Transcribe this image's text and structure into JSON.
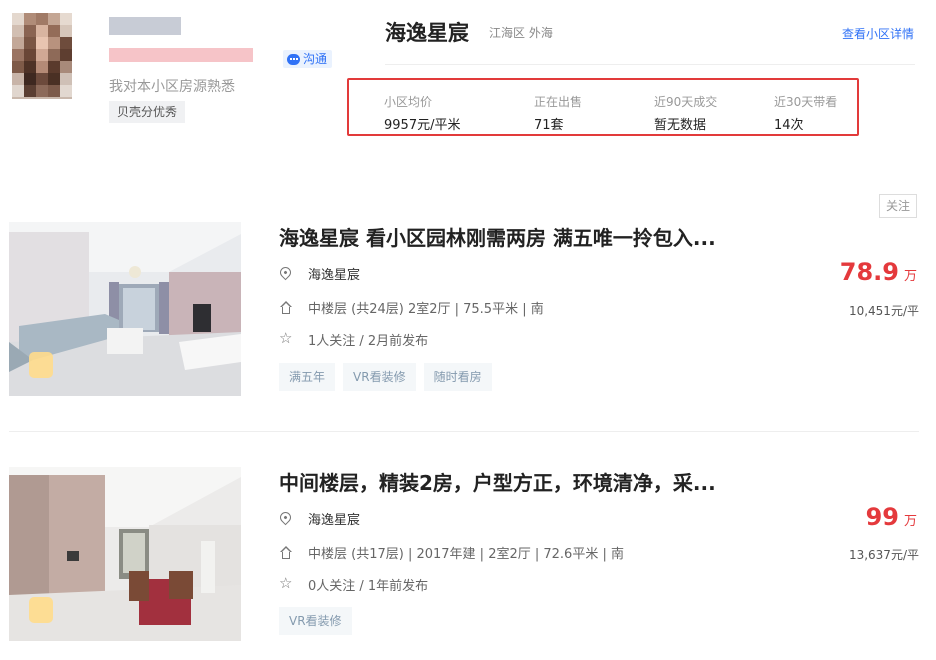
{
  "agent": {
    "description": "我对本小区房源熟悉",
    "badge": "贝壳分优秀",
    "chat_label": "沟通"
  },
  "community": {
    "name": "海逸星宸",
    "location": "江海区 外海",
    "detail_link": "查看小区详情",
    "stats": [
      {
        "label": "小区均价",
        "value": "9957元/平米"
      },
      {
        "label": "正在出售",
        "value": "71套"
      },
      {
        "label": "近90天成交",
        "value": "暂无数据"
      },
      {
        "label": "近30天带看",
        "value": "14次"
      }
    ]
  },
  "follow_label": "关注",
  "listings": [
    {
      "title": "海逸星宸 看小区园林刚需两房 满五唯一拎包入...",
      "community": "海逸星宸",
      "house_info": "中楼层 (共24层) 2室2厅 | 75.5平米 | 南",
      "follow_info": "1人关注 / 2月前发布",
      "tags": [
        "满五年",
        "VR看装修",
        "随时看房"
      ],
      "price_total": "78.9",
      "price_unit": "万",
      "unit_price": "10,451元/平"
    },
    {
      "title": "中间楼层，精装2房，户型方正，环境清净，采...",
      "community": "海逸星宸",
      "house_info": "中楼层 (共17层) | 2017年建 | 2室2厅 | 72.6平米 | 南",
      "follow_info": "0人关注 / 1年前发布",
      "tags": [
        "VR看装修"
      ],
      "price_total": "99",
      "price_unit": "万",
      "unit_price": "13,637元/平"
    }
  ],
  "colors": {
    "accent_blue": "#3072f6",
    "price_red": "#e4393c",
    "highlight_border": "#e23a3a"
  }
}
